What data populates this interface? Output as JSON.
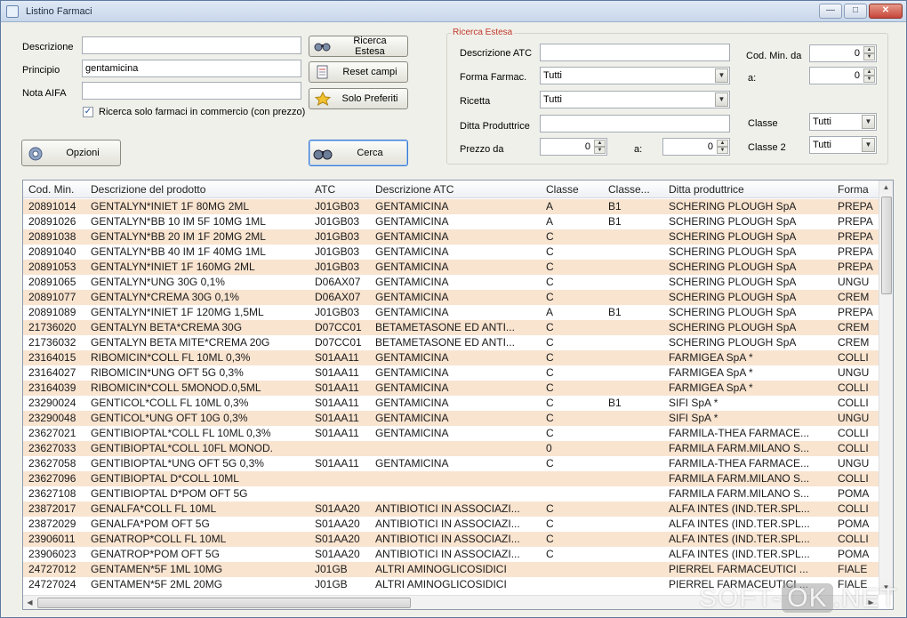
{
  "window": {
    "title": "Listino Farmaci"
  },
  "left_form": {
    "descrizione_label": "Descrizione",
    "descrizione_value": "",
    "principio_label": "Principio",
    "principio_value": "gentamicina",
    "nota_label": "Nota AIFA",
    "nota_value": "",
    "checkbox_label": "Ricerca solo farmaci in commercio (con prezzo)",
    "checkbox_checked": true
  },
  "buttons": {
    "ricerca_estesa": "Ricerca Estesa",
    "reset": "Reset campi",
    "preferiti": "Solo Preferiti",
    "opzioni": "Opzioni",
    "cerca": "Cerca"
  },
  "extended": {
    "group_title": "Ricerca Estesa",
    "descr_atc_label": "Descrizione ATC",
    "forma_label": "Forma Farmac.",
    "forma_value": "Tutti",
    "ricetta_label": "Ricetta",
    "ricetta_value": "Tutti",
    "ditta_label": "Ditta Produttrice",
    "prezzo_label": "Prezzo da",
    "prezzo_from": "0",
    "prezzo_a_label": "a:",
    "prezzo_to": "0",
    "cod_min_label": "Cod. Min. da",
    "cod_min_from": "0",
    "cod_a_label": "a:",
    "cod_min_to": "0",
    "classe_label": "Classe",
    "classe_value": "Tutti",
    "classe2_label": "Classe 2",
    "classe2_value": "Tutti"
  },
  "grid": {
    "headers": [
      "Cod. Min.",
      "Descrizione del prodotto",
      "ATC",
      "Descrizione ATC",
      "Classe",
      "Classe...",
      "Ditta produttrice",
      "Forma"
    ],
    "rows": [
      [
        "20891014",
        "GENTALYN*INIET 1F 80MG 2ML",
        "J01GB03",
        "GENTAMICINA",
        "A",
        "B1",
        "SCHERING PLOUGH SpA",
        "PREPA"
      ],
      [
        "20891026",
        "GENTALYN*BB 10 IM 5F 10MG 1ML",
        "J01GB03",
        "GENTAMICINA",
        "A",
        "B1",
        "SCHERING PLOUGH SpA",
        "PREPA"
      ],
      [
        "20891038",
        "GENTALYN*BB 20 IM 1F 20MG 2ML",
        "J01GB03",
        "GENTAMICINA",
        "C",
        "",
        "SCHERING PLOUGH SpA",
        "PREPA"
      ],
      [
        "20891040",
        "GENTALYN*BB 40 IM 1F 40MG 1ML",
        "J01GB03",
        "GENTAMICINA",
        "C",
        "",
        "SCHERING PLOUGH SpA",
        "PREPA"
      ],
      [
        "20891053",
        "GENTALYN*INIET 1F 160MG 2ML",
        "J01GB03",
        "GENTAMICINA",
        "C",
        "",
        "SCHERING PLOUGH SpA",
        "PREPA"
      ],
      [
        "20891065",
        "GENTALYN*UNG 30G 0,1%",
        "D06AX07",
        "GENTAMICINA",
        "C",
        "",
        "SCHERING PLOUGH SpA",
        "UNGU"
      ],
      [
        "20891077",
        "GENTALYN*CREMA 30G 0,1%",
        "D06AX07",
        "GENTAMICINA",
        "C",
        "",
        "SCHERING PLOUGH SpA",
        "CREM"
      ],
      [
        "20891089",
        "GENTALYN*INIET 1F 120MG 1,5ML",
        "J01GB03",
        "GENTAMICINA",
        "A",
        "B1",
        "SCHERING PLOUGH SpA",
        "PREPA"
      ],
      [
        "21736020",
        "GENTALYN BETA*CREMA 30G",
        "D07CC01",
        "BETAMETASONE ED ANTI...",
        "C",
        "",
        "SCHERING PLOUGH SpA",
        "CREM"
      ],
      [
        "21736032",
        "GENTALYN BETA MITE*CREMA 20G",
        "D07CC01",
        "BETAMETASONE ED ANTI...",
        "C",
        "",
        "SCHERING PLOUGH SpA",
        "CREM"
      ],
      [
        "23164015",
        "RIBOMICIN*COLL FL 10ML 0,3%",
        "S01AA11",
        "GENTAMICINA",
        "C",
        "",
        "FARMIGEA SpA          *",
        "COLLI"
      ],
      [
        "23164027",
        "RIBOMICIN*UNG OFT 5G 0,3%",
        "S01AA11",
        "GENTAMICINA",
        "C",
        "",
        "FARMIGEA SpA          *",
        "UNGU"
      ],
      [
        "23164039",
        "RIBOMICIN*COLL 5MONOD.0,5ML",
        "S01AA11",
        "GENTAMICINA",
        "C",
        "",
        "FARMIGEA SpA          *",
        "COLLI"
      ],
      [
        "23290024",
        "GENTICOL*COLL FL 10ML 0,3%",
        "S01AA11",
        "GENTAMICINA",
        "C",
        "B1",
        "SIFI SpA          *",
        "COLLI"
      ],
      [
        "23290048",
        "GENTICOL*UNG OFT 10G 0,3%",
        "S01AA11",
        "GENTAMICINA",
        "C",
        "",
        "SIFI SpA          *",
        "UNGU"
      ],
      [
        "23627021",
        "GENTIBIOPTAL*COLL FL 10ML 0,3%",
        "S01AA11",
        "GENTAMICINA",
        "C",
        "",
        "FARMILA-THEA FARMACE...",
        "COLLI"
      ],
      [
        "23627033",
        "GENTIBIOPTAL*COLL 10FL MONOD.",
        "",
        "",
        "0",
        "",
        "FARMILA FARM.MILANO S...",
        "COLLI"
      ],
      [
        "23627058",
        "GENTIBIOPTAL*UNG OFT 5G 0,3%",
        "S01AA11",
        "GENTAMICINA",
        "C",
        "",
        "FARMILA-THEA FARMACE...",
        "UNGU"
      ],
      [
        "23627096",
        "GENTIBIOPTAL D*COLL 10ML",
        "",
        "",
        "",
        "",
        "FARMILA FARM.MILANO S...",
        "COLLI"
      ],
      [
        "23627108",
        "GENTIBIOPTAL D*POM OFT 5G",
        "",
        "",
        "",
        "",
        "FARMILA FARM.MILANO S...",
        "POMA"
      ],
      [
        "23872017",
        "GENALFA*COLL FL 10ML",
        "S01AA20",
        "ANTIBIOTICI IN ASSOCIAZI...",
        "C",
        "",
        "ALFA INTES (IND.TER.SPL...",
        "COLLI"
      ],
      [
        "23872029",
        "GENALFA*POM OFT 5G",
        "S01AA20",
        "ANTIBIOTICI IN ASSOCIAZI...",
        "C",
        "",
        "ALFA INTES (IND.TER.SPL...",
        "POMA"
      ],
      [
        "23906011",
        "GENATROP*COLL FL 10ML",
        "S01AA20",
        "ANTIBIOTICI IN ASSOCIAZI...",
        "C",
        "",
        "ALFA INTES (IND.TER.SPL...",
        "COLLI"
      ],
      [
        "23906023",
        "GENATROP*POM OFT 5G",
        "S01AA20",
        "ANTIBIOTICI IN ASSOCIAZI...",
        "C",
        "",
        "ALFA INTES (IND.TER.SPL...",
        "POMA"
      ],
      [
        "24727012",
        "GENTAMEN*5F 1ML 10MG",
        "J01GB",
        "ALTRI AMINOGLICOSIDICI",
        "",
        "",
        "PIERREL FARMACEUTICI ...",
        "FIALE"
      ],
      [
        "24727024",
        "GENTAMEN*5F 2ML 20MG",
        "J01GB",
        "ALTRI AMINOGLICOSIDICI",
        "",
        "",
        "PIERREL FARMACEUTICI ...",
        "FIALE"
      ]
    ]
  },
  "watermark": {
    "left": "SOFT-",
    "ok": "OK",
    "right": ".NET"
  }
}
